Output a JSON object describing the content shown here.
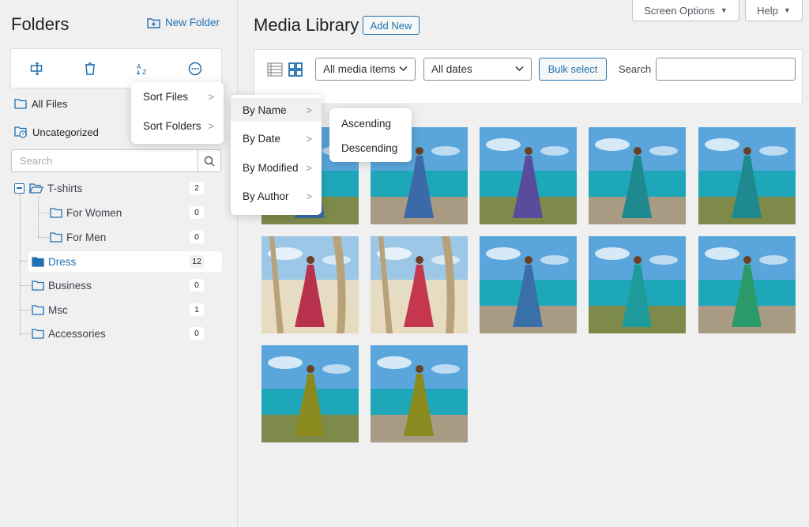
{
  "sidebar": {
    "title": "Folders",
    "new_folder": "New Folder",
    "all_files": "All Files",
    "uncategorized": "Uncategorized",
    "search_placeholder": "Search",
    "tree": [
      {
        "label": "T-shirts",
        "count": "2"
      },
      {
        "label": "For Women",
        "count": "0"
      },
      {
        "label": "For Men",
        "count": "0"
      },
      {
        "label": "Dress",
        "count": "12"
      },
      {
        "label": "Business",
        "count": "0"
      },
      {
        "label": "Msc",
        "count": "1"
      },
      {
        "label": "Accessories",
        "count": "0"
      }
    ]
  },
  "header": {
    "title": "Media Library",
    "add_new": "Add New",
    "screen_options": "Screen Options",
    "help": "Help"
  },
  "filters": {
    "media_type": "All media items",
    "dates": "All dates",
    "bulk_select": "Bulk select",
    "search_label": "Search"
  },
  "sort_menu": {
    "items": [
      "Sort Files",
      "Sort Folders"
    ]
  },
  "sort_by_menu": {
    "items": [
      "By Name",
      "By Date",
      "By Modified",
      "By Author"
    ]
  },
  "order_menu": {
    "items": [
      "Ascending",
      "Descending"
    ]
  },
  "colors": {
    "accent": "#2271b1",
    "active_folder": "#2271b1"
  },
  "media_items": [
    {
      "dress_color": "#3c6aa8"
    },
    {
      "dress_color": "#3c6aa8"
    },
    {
      "dress_color": "#5a4c9c"
    },
    {
      "dress_color": "#1e8a8f"
    },
    {
      "dress_color": "#1e8a8f"
    },
    {
      "dress_color": "#b8324d"
    },
    {
      "dress_color": "#c5364f"
    },
    {
      "dress_color": "#3a6fa8"
    },
    {
      "dress_color": "#1f9a9a"
    },
    {
      "dress_color": "#2a9a6a"
    },
    {
      "dress_color": "#8a8a1e"
    },
    {
      "dress_color": "#8a8a1e"
    }
  ]
}
